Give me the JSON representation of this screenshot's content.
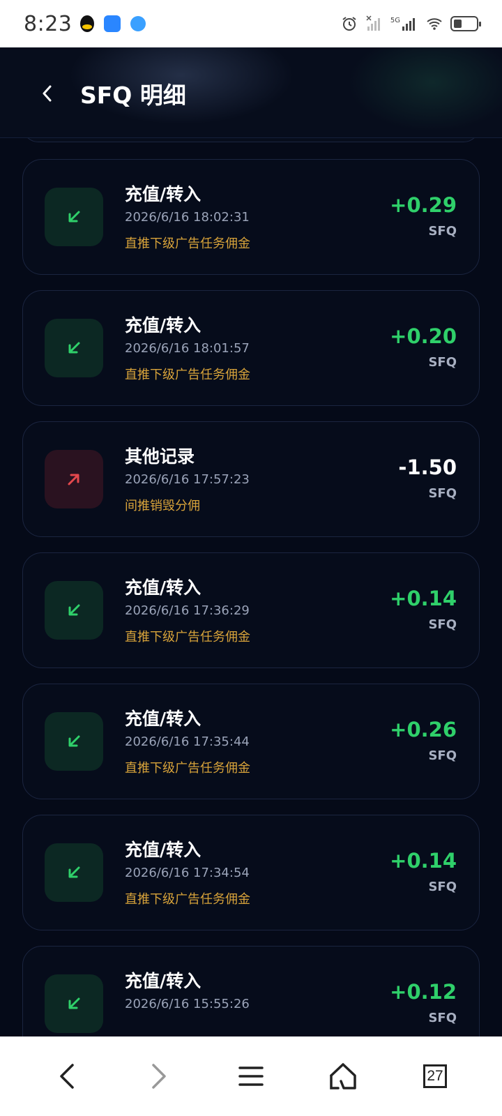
{
  "status_bar": {
    "time": "8:23",
    "signal_label": "5G"
  },
  "header": {
    "title": "SFQ 明细"
  },
  "records": [
    {
      "type": "in",
      "title": "充值/转入",
      "time": "2026/6/16 18:02:31",
      "note": "直推下级广告任务佣金",
      "amount": "+0.29",
      "unit": "SFQ"
    },
    {
      "type": "in",
      "title": "充值/转入",
      "time": "2026/6/16 18:01:57",
      "note": "直推下级广告任务佣金",
      "amount": "+0.20",
      "unit": "SFQ"
    },
    {
      "type": "out",
      "title": "其他记录",
      "time": "2026/6/16 17:57:23",
      "note": "间推销毁分佣",
      "amount": "-1.50",
      "unit": "SFQ"
    },
    {
      "type": "in",
      "title": "充值/转入",
      "time": "2026/6/16 17:36:29",
      "note": "直推下级广告任务佣金",
      "amount": "+0.14",
      "unit": "SFQ"
    },
    {
      "type": "in",
      "title": "充值/转入",
      "time": "2026/6/16 17:35:44",
      "note": "直推下级广告任务佣金",
      "amount": "+0.26",
      "unit": "SFQ"
    },
    {
      "type": "in",
      "title": "充值/转入",
      "time": "2026/6/16 17:34:54",
      "note": "直推下级广告任务佣金",
      "amount": "+0.14",
      "unit": "SFQ"
    },
    {
      "type": "in",
      "title": "充值/转入",
      "time": "2026/6/16 15:55:26",
      "note": "",
      "amount": "+0.12",
      "unit": "SFQ"
    }
  ],
  "browser_nav": {
    "tabs_count": "27"
  },
  "colors": {
    "positive": "#2fd06a",
    "note": "#d8a33a",
    "background": "#050a18"
  }
}
